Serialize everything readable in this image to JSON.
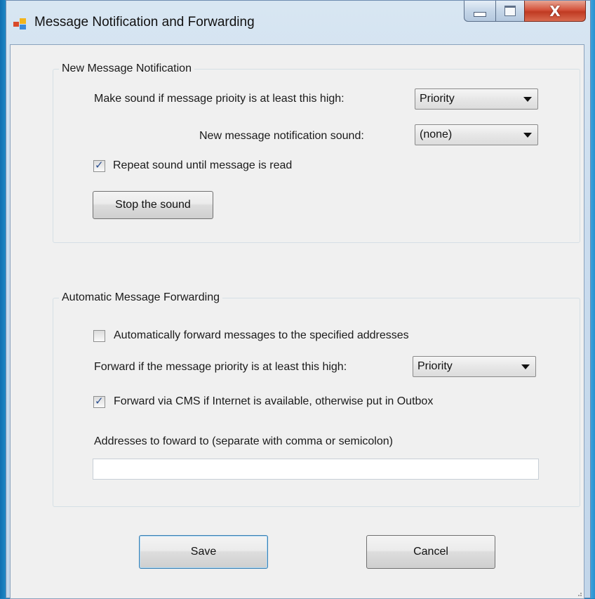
{
  "window": {
    "title": "Message Notification and Forwarding",
    "controls": {
      "minimize": "minimize",
      "maximize": "maximize",
      "close": "X"
    }
  },
  "notification": {
    "legend": "New Message Notification",
    "priority_label": "Make sound if message prioity is at least this high:",
    "priority_value": "Priority",
    "sound_label": "New message notification sound:",
    "sound_value": "(none)",
    "repeat_label": "Repeat sound until message is read",
    "repeat_checked": true,
    "stop_button": "Stop the sound"
  },
  "forwarding": {
    "legend": "Automatic Message Forwarding",
    "auto_forward_label": "Automatically forward messages to the specified addresses",
    "auto_forward_checked": false,
    "priority_label": "Forward if the message priority is at least this high:",
    "priority_value": "Priority",
    "cms_label": "Forward via CMS if Internet is available, otherwise put in Outbox",
    "cms_checked": true,
    "addresses_label": "Addresses to foward to (separate with comma or semicolon)",
    "addresses_value": ""
  },
  "buttons": {
    "save": "Save",
    "cancel": "Cancel"
  },
  "icons": {
    "app": "app-window-icon",
    "check": "checkmark-icon",
    "dropdown": "chevron-down-icon"
  },
  "colors": {
    "desktop": "#1a7fc0",
    "client_bg": "#f0f0f0",
    "close_red": "#c03a22",
    "check_blue": "#2b4f8f"
  }
}
